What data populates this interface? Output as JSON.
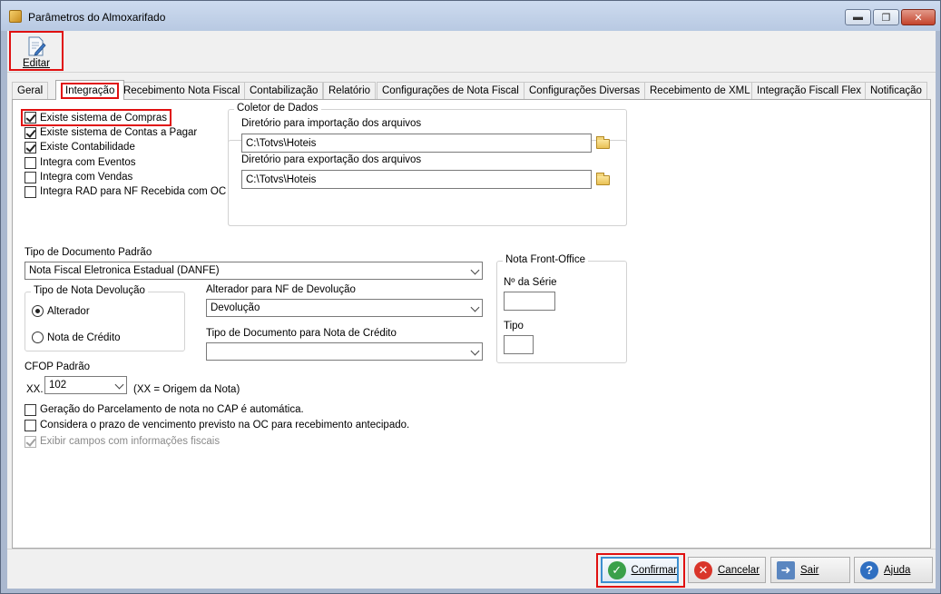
{
  "window": {
    "title": "Parâmetros do Almoxarifado",
    "min": "▬",
    "max": "❐",
    "close": "✕"
  },
  "toolbar": {
    "edit_label": "Editar"
  },
  "tabs": [
    "Geral",
    "Integração",
    "Recebimento Nota Fiscal",
    "Contabilização",
    "Relatório",
    "Configurações de Nota Fiscal",
    "Configurações Diversas",
    "Recebimento de XML",
    "Integração Fiscall Flex",
    "Notificação"
  ],
  "integracao": {
    "checks": [
      {
        "label": "Existe sistema de Compras",
        "checked": true
      },
      {
        "label": "Existe sistema de Contas a Pagar",
        "checked": true
      },
      {
        "label": "Existe Contabilidade",
        "checked": true
      },
      {
        "label": "Integra com Eventos",
        "checked": false
      },
      {
        "label": "Integra com Vendas",
        "checked": false
      },
      {
        "label": "Integra RAD para NF Recebida com OC",
        "checked": false
      }
    ],
    "coletor": {
      "legend": "Coletor de Dados",
      "import_label": "Diretório para importação dos arquivos",
      "import_value": "C:\\Totvs\\Hoteis",
      "export_label": "Diretório para exportação dos arquivos",
      "export_value": "C:\\Totvs\\Hoteis"
    },
    "tipo_doc_label": "Tipo de Documento Padrão",
    "tipo_doc_value": "Nota Fiscal Eletronica Estadual (DANFE)",
    "tipo_nota_dev": {
      "legend": "Tipo de Nota Devolução",
      "opt1": "Alterador",
      "opt2": "Nota de Crédito",
      "selected": "Alterador"
    },
    "alterador_label": "Alterador para NF de Devolução",
    "alterador_value": "Devolução",
    "tipo_doc_credito_label": "Tipo de Documento para Nota de Crédito",
    "tipo_doc_credito_value": "",
    "front_office": {
      "legend": "Nota Front-Office",
      "serie_label": "Nº da Série",
      "tipo_label": "Tipo"
    },
    "cfop": {
      "label": "CFOP Padrão",
      "prefix": "XX.",
      "value": "102",
      "hint": "(XX = Origem da Nota)"
    },
    "extra_checks": [
      {
        "label": "Geração do Parcelamento de nota no CAP é automática.",
        "checked": false,
        "disabled": false
      },
      {
        "label": "Considera o prazo de vencimento previsto na OC para recebimento antecipado.",
        "checked": false,
        "disabled": false
      },
      {
        "label": "Exibir campos com informações fiscais",
        "checked": true,
        "disabled": true
      }
    ]
  },
  "buttons": {
    "confirm": "Confirmar",
    "cancel": "Cancelar",
    "exit": "Sair",
    "help": "Ajuda"
  },
  "colors": {
    "highlight": "#e01010",
    "confirm_icon": "#3aa04a",
    "cancel_icon": "#d9352a",
    "help_icon": "#2f6fc1"
  }
}
